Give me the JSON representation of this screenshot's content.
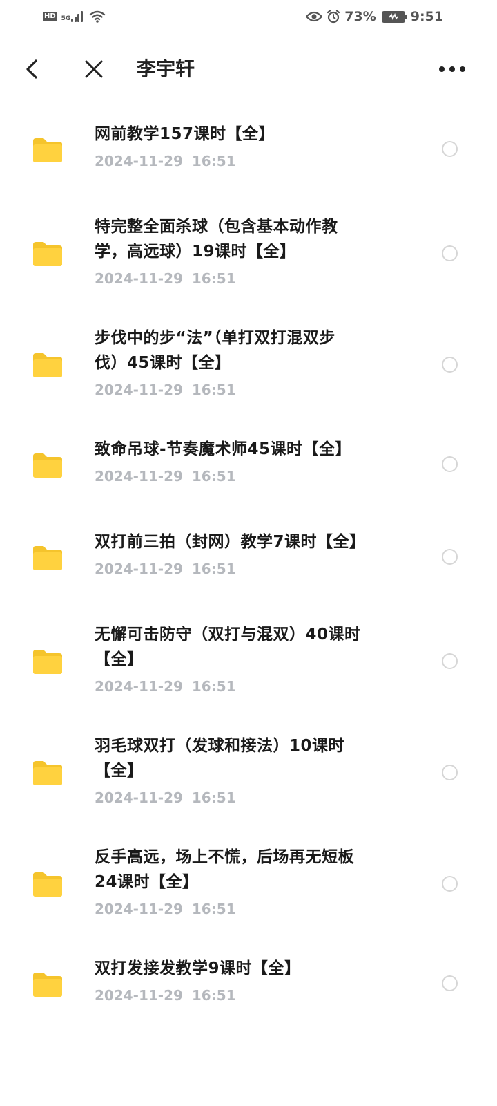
{
  "status_bar": {
    "hd_label": "HD",
    "network_label": "5G",
    "battery_percent": "73%",
    "time": "9:51",
    "icons": [
      "signal-icon",
      "wifi-icon",
      "eye-icon",
      "alarm-icon",
      "battery-icon"
    ]
  },
  "header": {
    "title": "李宇轩",
    "icons": [
      "back-icon",
      "close-icon",
      "more-icon"
    ]
  },
  "colors": {
    "folder": "#FFD23F",
    "folder_tab": "#F5C42C",
    "date_text": "#b5b8bd",
    "radio_border": "#d6d6d6"
  },
  "files": [
    {
      "name_lines": [
        "网前教学157课时【全】"
      ],
      "date": "2024-11-29 16:51"
    },
    {
      "name_lines": [
        "特完整全面杀球（包含基本动作教",
        "学，高远球）19课时【全】"
      ],
      "date": "2024-11-29 16:51"
    },
    {
      "name_lines": [
        "步伐中的步“法”（单打双打混双步",
        "伐）45课时【全】"
      ],
      "date": "2024-11-29 16:51"
    },
    {
      "name_lines": [
        "致命吊球-节奏魔术师45课时【全】"
      ],
      "date": "2024-11-29 16:51"
    },
    {
      "name_lines": [
        "双打前三拍（封网）教学7课时【全】"
      ],
      "date": "2024-11-29 16:51"
    },
    {
      "name_lines": [
        "无懈可击防守（双打与混双）40课时",
        "【全】"
      ],
      "date": "2024-11-29 16:51"
    },
    {
      "name_lines": [
        "羽毛球双打（发球和接法）10课时",
        "【全】"
      ],
      "date": "2024-11-29 16:51"
    },
    {
      "name_lines": [
        "反手高远，场上不慌，后场再无短板",
        "24课时【全】"
      ],
      "date": "2024-11-29 16:51"
    },
    {
      "name_lines": [
        "双打发接发教学9课时【全】"
      ],
      "date": "2024-11-29 16:51"
    }
  ]
}
